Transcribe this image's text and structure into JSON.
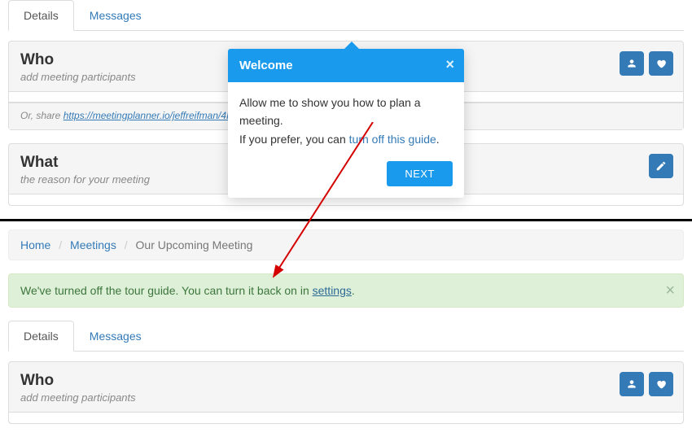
{
  "top": {
    "tabs": {
      "details": "Details",
      "messages": "Messages"
    },
    "who": {
      "title": "Who",
      "subtitle": "add meeting participants",
      "share_prefix": "Or, share ",
      "share_url": "https://meetingplanner.io/jeffreifman/4Idx"
    },
    "what": {
      "title": "What",
      "subtitle": "the reason for your meeting"
    }
  },
  "popover": {
    "title": "Welcome",
    "line1": "Allow me to show you how to plan a meeting.",
    "line2_prefix": "If you prefer, you can ",
    "line2_link": "turn off this guide",
    "line2_suffix": ".",
    "next": "NEXT"
  },
  "bottom": {
    "breadcrumb": {
      "home": "Home",
      "meetings": "Meetings",
      "current": "Our Upcoming Meeting"
    },
    "alert": {
      "text_prefix": "We've turned off the tour guide. You can turn it back on in ",
      "link": "settings",
      "text_suffix": "."
    },
    "tabs": {
      "details": "Details",
      "messages": "Messages"
    },
    "who": {
      "title": "Who",
      "subtitle": "add meeting participants"
    }
  }
}
